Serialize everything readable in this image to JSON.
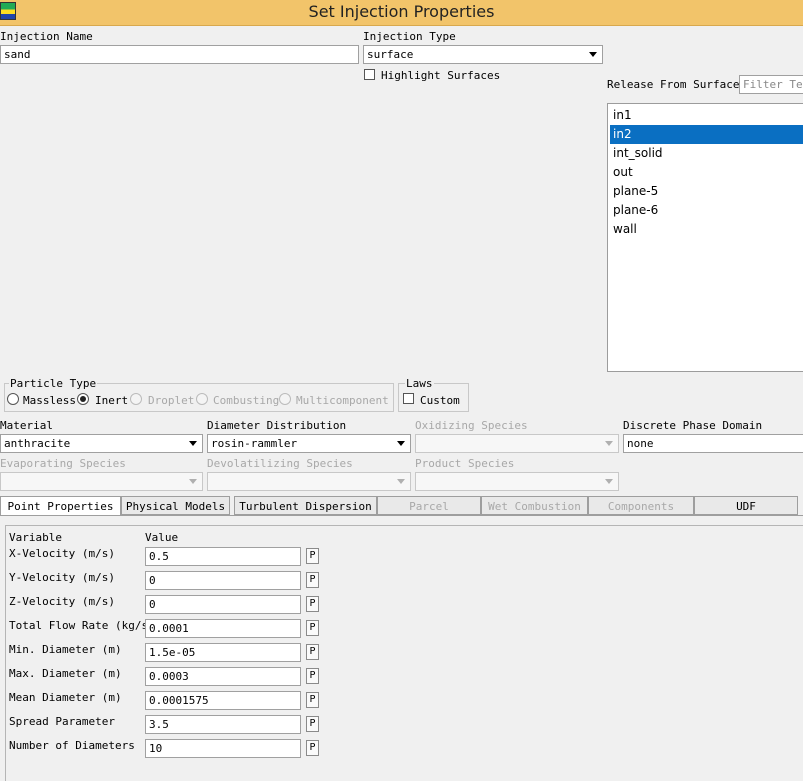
{
  "window": {
    "title": "Set Injection Properties"
  },
  "injection_name": {
    "label": "Injection Name",
    "value": "sand"
  },
  "injection_type": {
    "label": "Injection Type",
    "value": "surface"
  },
  "highlight_surfaces": {
    "label": "Highlight Surfaces",
    "checked": false
  },
  "release_from_surfaces": {
    "label": "Release From Surfaces",
    "filter_placeholder": "Filter Text",
    "items": [
      "in1",
      "in2",
      "int_solid",
      "out",
      "plane-5",
      "plane-6",
      "wall"
    ],
    "selected": "in2"
  },
  "particle_type": {
    "label": "Particle Type",
    "options": [
      {
        "label": "Massless",
        "checked": false,
        "enabled": true
      },
      {
        "label": "Inert",
        "checked": true,
        "enabled": true
      },
      {
        "label": "Droplet",
        "checked": false,
        "enabled": false
      },
      {
        "label": "Combusting",
        "checked": false,
        "enabled": false
      },
      {
        "label": "Multicomponent",
        "checked": false,
        "enabled": false
      }
    ]
  },
  "laws": {
    "label": "Laws",
    "custom_label": "Custom",
    "custom_checked": false
  },
  "material": {
    "label": "Material",
    "value": "anthracite"
  },
  "diameter_distribution": {
    "label": "Diameter Distribution",
    "value": "rosin-rammler"
  },
  "oxidizing_species": {
    "label": "Oxidizing Species",
    "value": ""
  },
  "discrete_phase_domain": {
    "label": "Discrete Phase Domain",
    "value": "none"
  },
  "evaporating_species": {
    "label": "Evaporating Species",
    "value": ""
  },
  "devolatilizing_species": {
    "label": "Devolatilizing Species",
    "value": ""
  },
  "product_species": {
    "label": "Product Species",
    "value": ""
  },
  "tabs": [
    {
      "label": "Point Properties",
      "active": true,
      "enabled": true
    },
    {
      "label": "Physical Models",
      "active": false,
      "enabled": true
    },
    {
      "label": "Turbulent Dispersion",
      "active": false,
      "enabled": true
    },
    {
      "label": "Parcel",
      "active": false,
      "enabled": false
    },
    {
      "label": "Wet Combustion",
      "active": false,
      "enabled": false
    },
    {
      "label": "Components",
      "active": false,
      "enabled": false
    },
    {
      "label": "UDF",
      "active": false,
      "enabled": true
    }
  ],
  "point_properties": {
    "col_variable": "Variable",
    "col_value": "Value",
    "param_button": "P",
    "rows": [
      {
        "variable": "X-Velocity (m/s)",
        "value": "0.5"
      },
      {
        "variable": "Y-Velocity (m/s)",
        "value": "0"
      },
      {
        "variable": "Z-Velocity (m/s)",
        "value": "0"
      },
      {
        "variable": "Total Flow Rate (kg/s)",
        "value": "0.0001"
      },
      {
        "variable": "Min. Diameter (m)",
        "value": "1.5e-05"
      },
      {
        "variable": "Max. Diameter (m)",
        "value": "0.0003"
      },
      {
        "variable": "Mean Diameter (m)",
        "value": "0.0001575"
      },
      {
        "variable": "Spread Parameter",
        "value": "3.5"
      },
      {
        "variable": "Number of Diameters",
        "value": "10"
      }
    ]
  }
}
